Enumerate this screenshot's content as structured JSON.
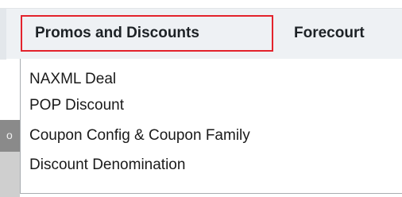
{
  "menubar": {
    "active_item": "Promos and Discounts",
    "next_item": "Forecourt",
    "highlight_color": "#e3232c"
  },
  "dropdown": {
    "items": [
      {
        "label": "NAXML Deal"
      },
      {
        "label": "POP Discount"
      },
      {
        "label": "Coupon Config & Coupon Family"
      },
      {
        "label": "Discount Denomination"
      }
    ]
  },
  "background": {
    "partial_glyph": "o"
  }
}
